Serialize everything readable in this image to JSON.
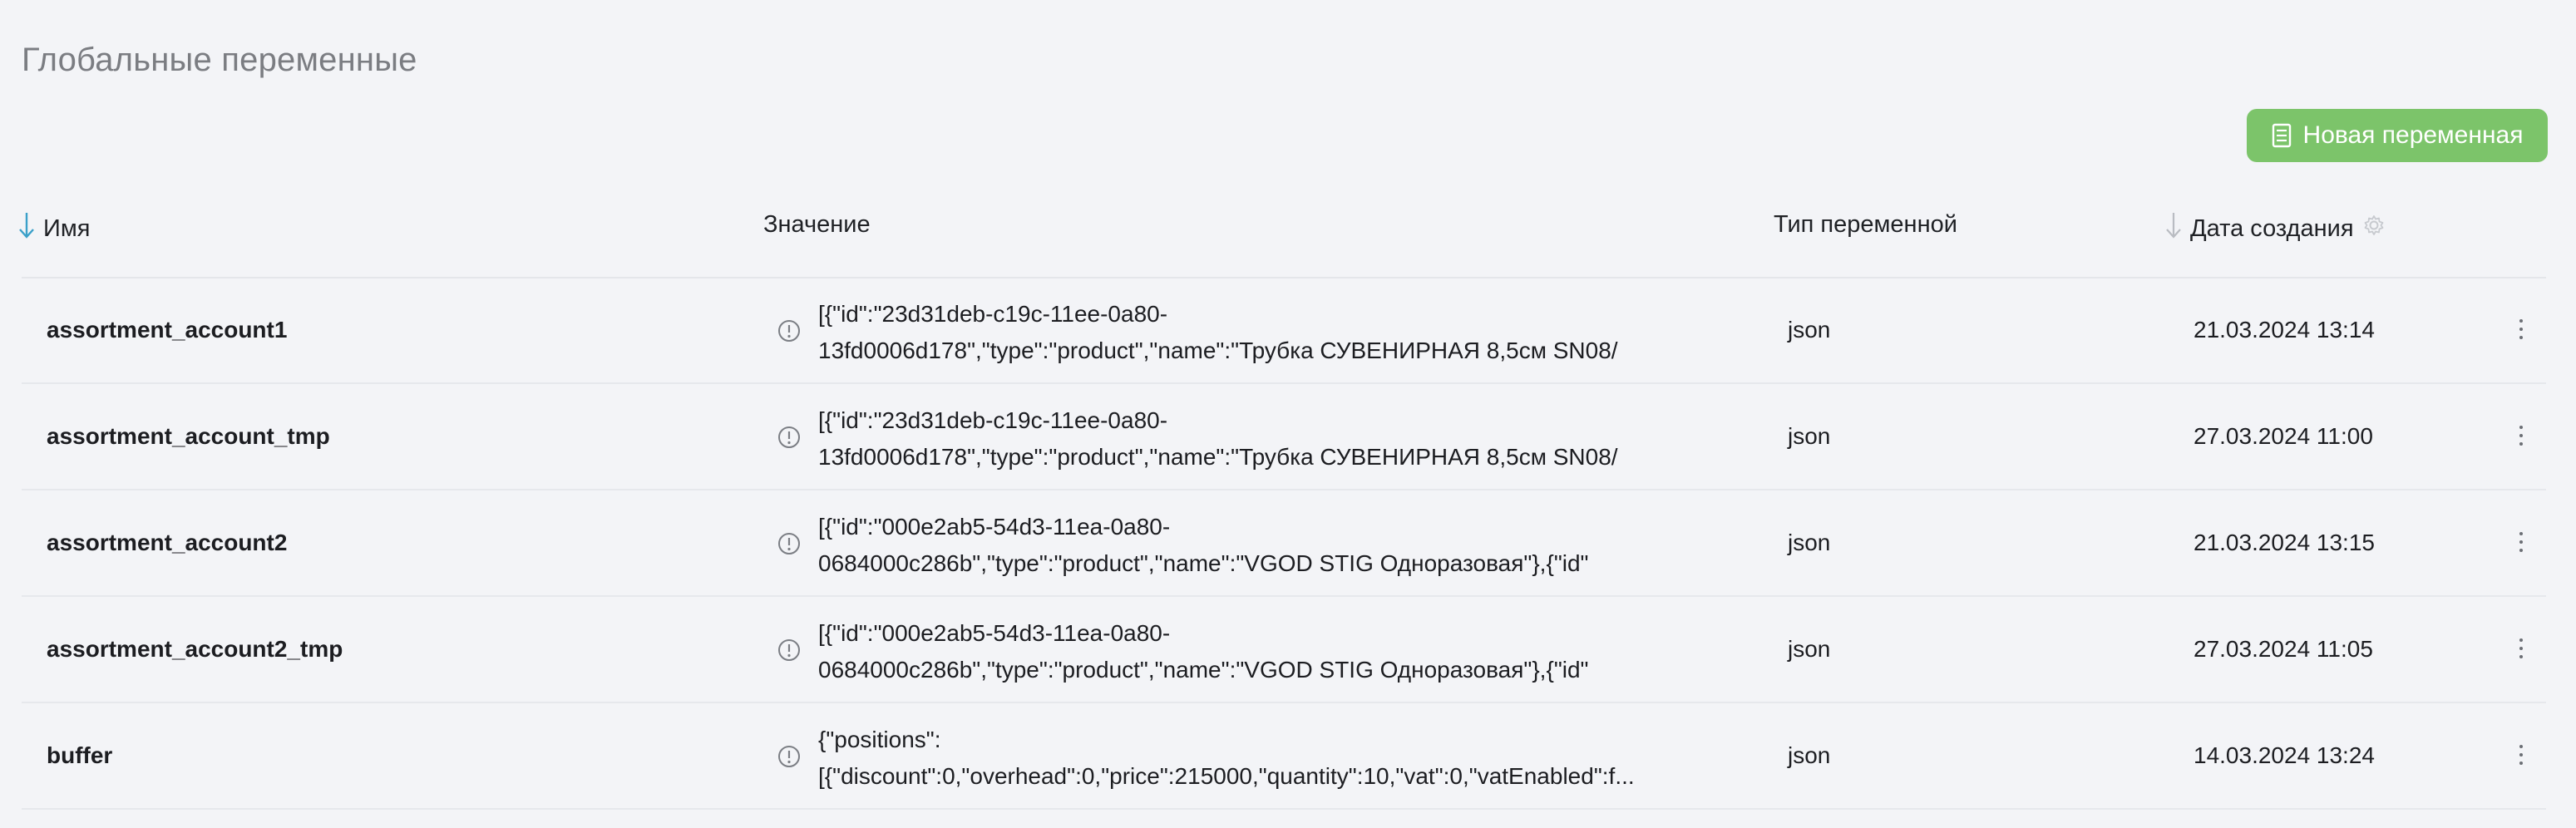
{
  "page": {
    "title": "Глобальные переменные"
  },
  "toolbar": {
    "new_variable_label": "Новая переменная",
    "new_variable_icon": "document-list-icon",
    "accent_color": "#7cc46a"
  },
  "table": {
    "columns": {
      "name": "Имя",
      "value": "Значение",
      "type": "Тип переменной",
      "created": "Дата создания"
    },
    "sort_active_color": "#3aa0c9",
    "rows": [
      {
        "name": "assortment_account1",
        "value_line1": "[{\"id\":\"23d31deb-c19c-11ee-0a80-",
        "value_line2": "13fd0006d178\",\"type\":\"product\",\"name\":\"Трубка СУВЕНИРНАЯ 8,5см SN08/",
        "type": "json",
        "created": "21.03.2024 13:14"
      },
      {
        "name": "assortment_account_tmp",
        "value_line1": "[{\"id\":\"23d31deb-c19c-11ee-0a80-",
        "value_line2": "13fd0006d178\",\"type\":\"product\",\"name\":\"Трубка СУВЕНИРНАЯ 8,5см SN08/",
        "type": "json",
        "created": "27.03.2024 11:00"
      },
      {
        "name": "assortment_account2",
        "value_line1": "[{\"id\":\"000e2ab5-54d3-11ea-0a80-",
        "value_line2": "0684000c286b\",\"type\":\"product\",\"name\":\"VGOD STIG Одноразовая\"},{\"id\"",
        "type": "json",
        "created": "21.03.2024 13:15"
      },
      {
        "name": "assortment_account2_tmp",
        "value_line1": "[{\"id\":\"000e2ab5-54d3-11ea-0a80-",
        "value_line2": "0684000c286b\",\"type\":\"product\",\"name\":\"VGOD STIG Одноразовая\"},{\"id\"",
        "type": "json",
        "created": "27.03.2024 11:05"
      },
      {
        "name": "buffer",
        "value_line1": "{\"positions\":",
        "value_line2": "[{\"discount\":0,\"overhead\":0,\"price\":215000,\"quantity\":10,\"vat\":0,\"vatEnabled\":f...",
        "type": "json",
        "created": "14.03.2024 13:24"
      }
    ]
  }
}
